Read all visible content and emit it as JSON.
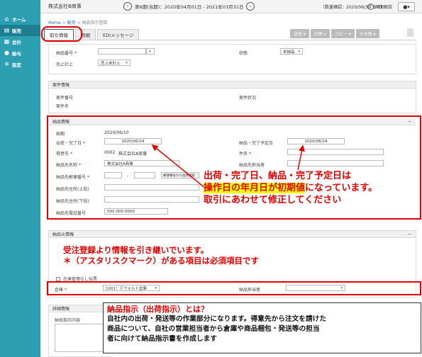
{
  "header": {
    "company": "株式会社B商事",
    "period": "第6期(当期)：2020年04月01日 - 2021年03月31日",
    "fiscal_note": "（数量確認：2020/06/30 まで）",
    "reset_label": "画面解説",
    "user_label": "▾"
  },
  "sidebar": {
    "items": [
      {
        "label": "ホーム",
        "icon": "home-icon",
        "glyph": "⌂"
      },
      {
        "label": "販売",
        "icon": "cart-icon",
        "glyph": "▤"
      },
      {
        "label": "会計",
        "icon": "ledger-icon",
        "glyph": "▦"
      },
      {
        "label": "給与",
        "icon": "money-bag-icon",
        "glyph": "●"
      },
      {
        "label": "設定",
        "icon": "gear-icon",
        "glyph": "✲"
      }
    ]
  },
  "breadcrumb": {
    "home": "Home",
    "sep1": " > ",
    "sales": "販売",
    "sep2": " > ",
    "current": "納品指示登録"
  },
  "tabs": [
    "取引情報",
    "明細",
    "EDIメッセージ"
  ],
  "actions": [
    "送信 ▾",
    "印刷 ▾",
    "コピー ▾",
    "その他 ▾"
  ],
  "top_form": {
    "delivery_no_label": "納品番号",
    "status_label": "状態",
    "status_value": "未納品",
    "sales_posting_label": "売上計上",
    "sales_posting_value": "売上未計上"
  },
  "case_info": {
    "title": "案件情報",
    "case_no_label": "案件番号",
    "case_name_label": "案件名",
    "case_status_label": "案件状況"
  },
  "delivery_info": {
    "title": "納品情報",
    "due_label": "納期",
    "due_value": "2020/06/10",
    "ship_date_label": "出荷・完了日",
    "ship_date_value": "2020/06/24",
    "deliv_complete_label": "納品・完了予定日",
    "deliv_complete_value": "2020/06/24",
    "customer_label": "得意先",
    "customer_code": "0002",
    "customer_name": "株式会社A商事",
    "subject_label": "件名",
    "deliv_name_label": "納品先名称",
    "deliv_name_value": "株式会社A商事",
    "deliv_person_label": "納品先担当者",
    "zip_label": "納品先郵便番号",
    "zip_sep": "-",
    "zip_button": "郵便番号から住所検索",
    "addr1_label": "納品先住所(上段)",
    "addr2_label": "納品先住所(下段)",
    "phone_label": "納品先電話番号",
    "phone_value": "092-000-0000"
  },
  "source_info": {
    "title": "納品元情報",
    "inventory_label": "在庫管理なし伝票",
    "warehouse_label": "倉庫",
    "warehouse_value": "1001：デフォルト倉庫",
    "person_label": "納品担当者"
  },
  "detail_info": {
    "title": "詳細情報",
    "instruction_label": "納品指示内容"
  },
  "callouts": {
    "c1_line1": "出荷・完了日、納品・完了予定日は",
    "c1_line2_hl": "操作日の年月日が初期値",
    "c1_line2_rest": "になっています。",
    "c1_line3": "取引にあわせて修正してください",
    "c2_line1": "受注登録より情報を引き継いでいます。",
    "c2_line2": "＊（アスタリスクマーク）がある項目は必須項目です",
    "info_title": "納品指示（出荷指示）とは？",
    "info_line1": "自社内の出荷・発送等の作業部分になります。得意先から注文を請けた",
    "info_line2": "商品について、自社の営業担当者から倉庫や商品梱包・発送等の担当",
    "info_line3": "者に向けて納品指示書を作成します"
  },
  "colors": {
    "sidebar": "#2c9fb2",
    "sidebar_active": "#1e7f91",
    "annotation_red": "#e30000",
    "highlight": "#ffff00"
  }
}
